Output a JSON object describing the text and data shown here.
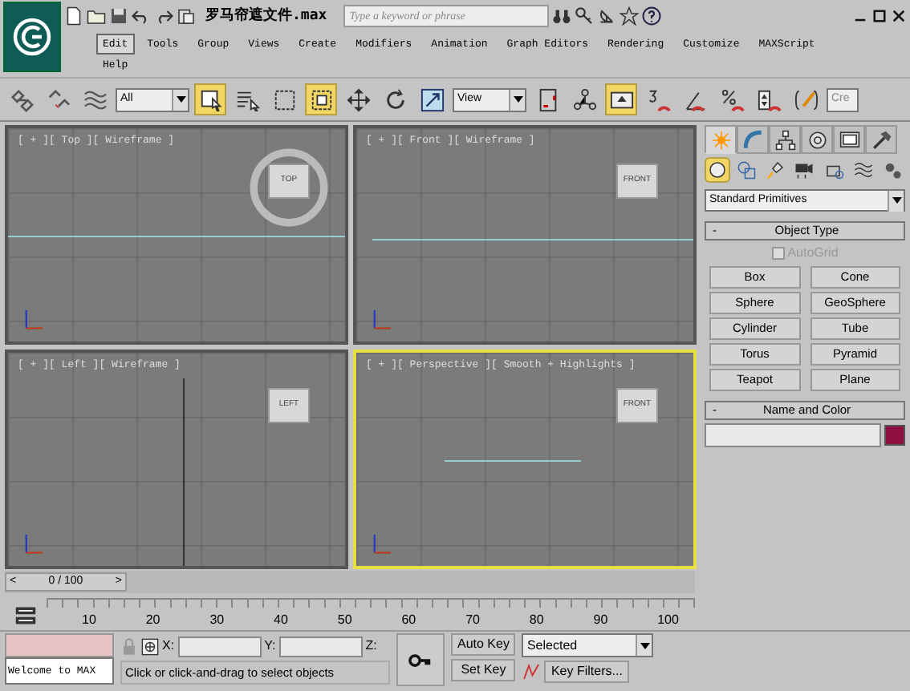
{
  "title_bar": {
    "file_name": "罗马帘遮文件.max",
    "search_placeholder": "Type a keyword or phrase"
  },
  "menu": [
    {
      "label": "Edit",
      "selected": true
    },
    {
      "label": "Tools",
      "selected": false
    },
    {
      "label": "Group",
      "selected": false
    },
    {
      "label": "Views",
      "selected": false
    },
    {
      "label": "Create",
      "selected": false
    },
    {
      "label": "Modifiers",
      "selected": false
    },
    {
      "label": "Animation",
      "selected": false
    },
    {
      "label": "Graph Editors",
      "selected": false
    },
    {
      "label": "Rendering",
      "selected": false
    },
    {
      "label": "Customize",
      "selected": false
    },
    {
      "label": "MAXScript",
      "selected": false
    },
    {
      "label": "Help",
      "selected": false
    }
  ],
  "toolbar": {
    "selection_filter": "All",
    "reference_coordinate": "View",
    "named_selection": "Cre",
    "buttons": [
      {
        "selected": false
      },
      {
        "selected": false
      },
      {
        "selected": false
      },
      {
        "selected": true
      },
      {
        "selected": false
      },
      {
        "selected": false
      },
      {
        "selected": true
      },
      {
        "selected": false
      },
      {
        "selected": false
      },
      {
        "selected": false
      },
      {
        "selected": false
      },
      {
        "selected": false
      },
      {
        "selected": true
      },
      {
        "selected": false
      },
      {
        "selected": false
      },
      {
        "selected": false
      },
      {
        "selected": false
      },
      {
        "selected": false
      }
    ]
  },
  "viewports": [
    {
      "label": "[ + ][ Top ][ Wireframe ]",
      "cube": "TOP",
      "active": false
    },
    {
      "label": "[ + ][ Front ][ Wireframe ]",
      "cube": "FRONT",
      "active": false
    },
    {
      "label": "[ + ][ Left ][ Wireframe ]",
      "cube": "LEFT",
      "active": false
    },
    {
      "label": "[ + ][ Perspective ][ Smooth + Highlights ]",
      "cube": "FRONT",
      "active": true
    }
  ],
  "command_panel": {
    "tabs": [
      {
        "selected": true
      },
      {
        "selected": false
      },
      {
        "selected": false
      },
      {
        "selected": false
      },
      {
        "selected": false
      },
      {
        "selected": false
      }
    ],
    "categories": [
      {
        "selected": true
      },
      {
        "selected": false
      },
      {
        "selected": false
      },
      {
        "selected": false
      },
      {
        "selected": false
      },
      {
        "selected": false
      },
      {
        "selected": false
      }
    ],
    "dropdown": "Standard Primitives",
    "object_type": {
      "title": "Object Type",
      "collapse": "-",
      "autogrid": {
        "label": "AutoGrid",
        "checked": false,
        "disabled": true
      },
      "buttons": [
        "Box",
        "Cone",
        "Sphere",
        "GeoSphere",
        "Cylinder",
        "Tube",
        "Torus",
        "Pyramid",
        "Teapot",
        "Plane"
      ]
    },
    "name_and_color": {
      "title": "Name and Color",
      "collapse": "-",
      "color": "#8e1040"
    }
  },
  "time_slider": {
    "label": "0 / 100",
    "prev": "<",
    "next": ">",
    "level": 0
  },
  "track_bar": {
    "ticks": [
      "10",
      "20",
      "30",
      "40",
      "50",
      "60",
      "70",
      "80",
      "90",
      "100"
    ]
  },
  "status_bar": {
    "listener": "Welcome to MAX",
    "prompt": "Click or click-and-drag to select objects",
    "x_label": "X:",
    "y_label": "Y:",
    "z_label": "Z:",
    "auto_key": "Auto Key",
    "set_key": "Set Key",
    "key_mode": "Selected",
    "key_filters": "Key Filters..."
  }
}
